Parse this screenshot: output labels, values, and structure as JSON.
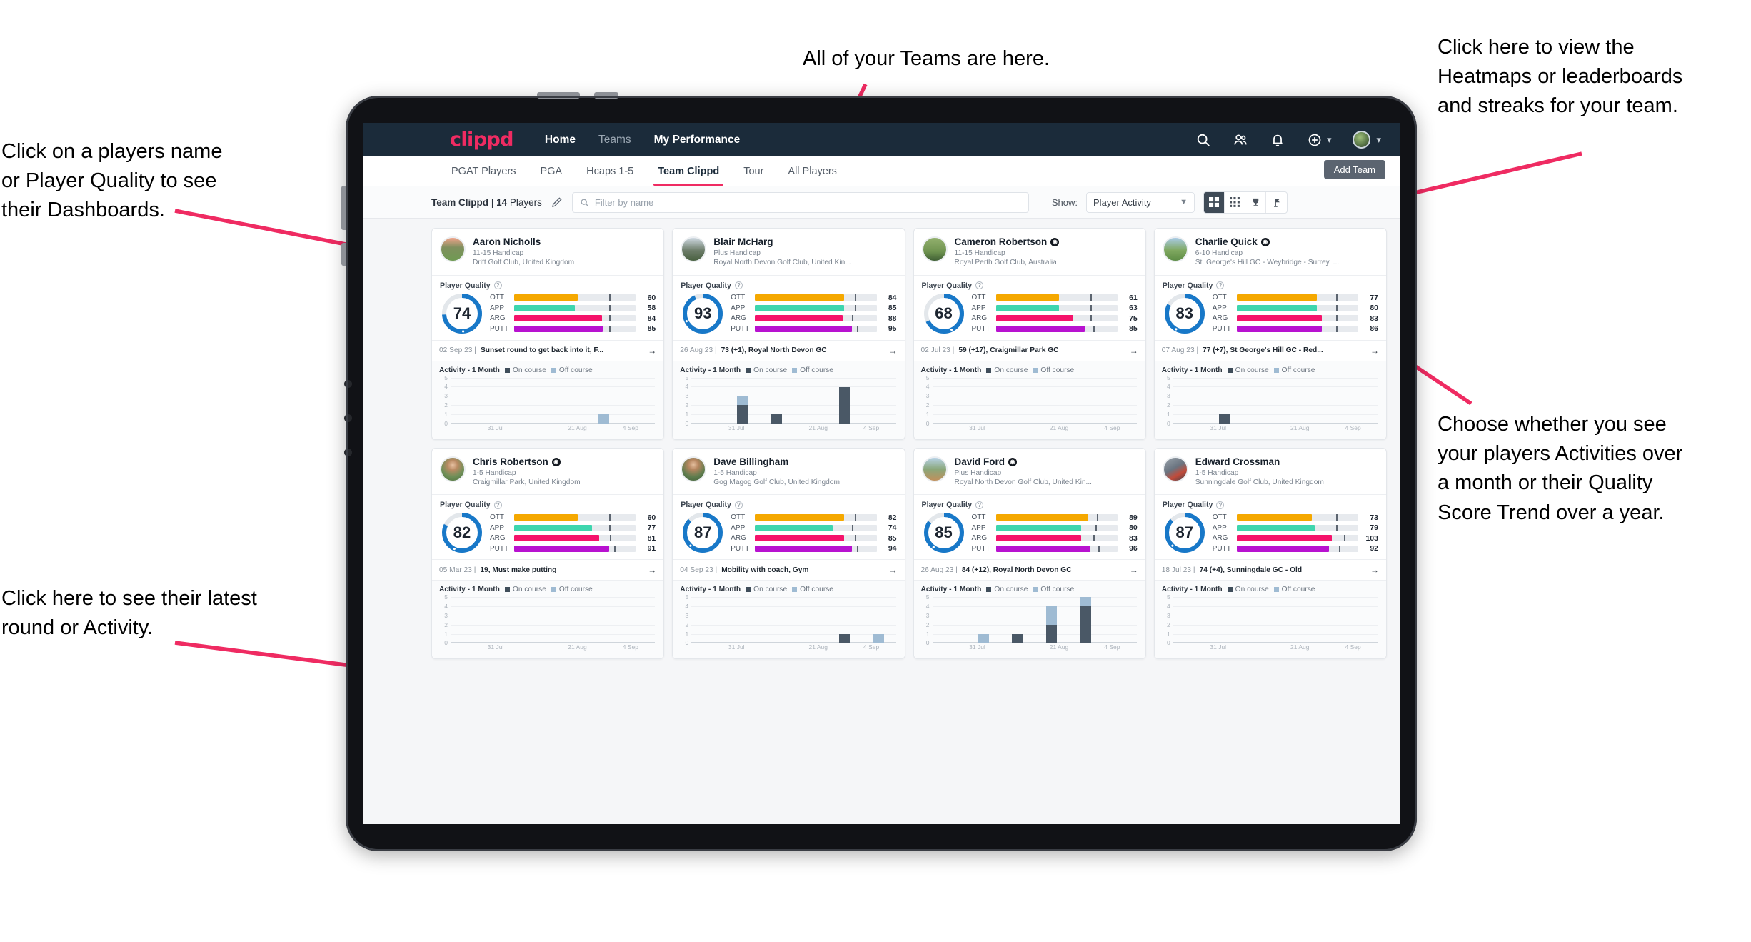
{
  "annotations": {
    "top": "All of your Teams are here.",
    "left_top": "Click on a players name\nor Player Quality to see\ntheir Dashboards.",
    "left_bottom": "Click here to see their latest\nround or Activity.",
    "top_right": "Click here to view the\nHeatmaps or leaderboards\nand streaks for your team.",
    "bottom_right": "Choose whether you see\nyour players Activities over\na month or their Quality\nScore Trend over a year.",
    "arrow_color": "#ef2b62"
  },
  "topnav": {
    "brand": "clippd",
    "links": [
      {
        "label": "Home",
        "active": true
      },
      {
        "label": "Teams",
        "active": false
      },
      {
        "label": "My Performance",
        "active": true
      }
    ],
    "icons": [
      "search-icon",
      "people-icon",
      "bell-icon",
      "plus-circle-icon",
      "avatar"
    ],
    "background": "#1b2b3a"
  },
  "subtabs": {
    "items": [
      {
        "label": "PGAT Players",
        "active": false
      },
      {
        "label": "PGA",
        "active": false
      },
      {
        "label": "Hcaps 1-5",
        "active": false
      },
      {
        "label": "Team Clippd",
        "active": true
      },
      {
        "label": "Tour",
        "active": false
      },
      {
        "label": "All Players",
        "active": false
      }
    ],
    "add_team_label": "Add Team",
    "active_underline_color": "#ef2b62"
  },
  "toolbar": {
    "team_name": "Team Clippd",
    "separator": "|",
    "player_count": "14",
    "players_word": "Players",
    "edit_icon": "pencil-icon",
    "search_placeholder": "Filter by name",
    "show_label": "Show:",
    "show_value": "Player Activity",
    "view_buttons": [
      "grid-large-icon",
      "grid-small-icon",
      "trophy-icon",
      "flag-icon"
    ],
    "active_view": 0
  },
  "card_labels": {
    "player_quality": "Player Quality",
    "activity_title": "Activity - 1 Month",
    "legend_on": "On course",
    "legend_off": "Off course",
    "metric_names": [
      "OTT",
      "APP",
      "ARG",
      "PUTT"
    ],
    "metric_colors": [
      "#f5a800",
      "#3ed6ae",
      "#f5136b",
      "#b812d0"
    ],
    "ring_color": "#1878c8",
    "y_ticks": [
      "5",
      "4",
      "3",
      "2",
      "1",
      "0"
    ],
    "x_ticks": [
      "31 Jul",
      "21 Aug",
      "4 Sep"
    ]
  },
  "players": [
    {
      "name": "Aaron Nicholls",
      "verified": false,
      "handicap": "11-15 Handicap",
      "club": "Drift Golf Club, United Kingdom",
      "quality": 74,
      "metrics": [
        {
          "name": "OTT",
          "value": 60,
          "fill_pct": 52,
          "tick_pct": 78
        },
        {
          "name": "APP",
          "value": 58,
          "fill_pct": 50,
          "tick_pct": 78
        },
        {
          "name": "ARG",
          "value": 84,
          "fill_pct": 72,
          "tick_pct": 78
        },
        {
          "name": "PUTT",
          "value": 85,
          "fill_pct": 73,
          "tick_pct": 78
        }
      ],
      "round_date": "02 Sep 23",
      "round_text": "Sunset round to get back into it, F...",
      "activity": [
        {
          "on": 0,
          "off": 0
        },
        {
          "on": 0,
          "off": 0
        },
        {
          "on": 0,
          "off": 0
        },
        {
          "on": 0,
          "off": 0
        },
        {
          "on": 0,
          "off": 1
        },
        {
          "on": 0,
          "off": 0
        }
      ]
    },
    {
      "name": "Blair McHarg",
      "verified": false,
      "handicap": "Plus Handicap",
      "club": "Royal North Devon Golf Club, United Kin...",
      "quality": 93,
      "metrics": [
        {
          "name": "OTT",
          "value": 84,
          "fill_pct": 73,
          "tick_pct": 82
        },
        {
          "name": "APP",
          "value": 85,
          "fill_pct": 73,
          "tick_pct": 82
        },
        {
          "name": "ARG",
          "value": 88,
          "fill_pct": 72,
          "tick_pct": 80
        },
        {
          "name": "PUTT",
          "value": 95,
          "fill_pct": 80,
          "tick_pct": 84
        }
      ],
      "round_date": "26 Aug 23",
      "round_text": "73 (+1), Royal North Devon GC",
      "activity": [
        {
          "on": 0,
          "off": 0
        },
        {
          "on": 2,
          "off": 1
        },
        {
          "on": 1,
          "off": 0
        },
        {
          "on": 0,
          "off": 0
        },
        {
          "on": 4,
          "off": 0
        },
        {
          "on": 0,
          "off": 0
        }
      ]
    },
    {
      "name": "Cameron Robertson",
      "verified": true,
      "handicap": "11-15 Handicap",
      "club": "Royal Perth Golf Club, Australia",
      "quality": 68,
      "metrics": [
        {
          "name": "OTT",
          "value": 61,
          "fill_pct": 52,
          "tick_pct": 78
        },
        {
          "name": "APP",
          "value": 63,
          "fill_pct": 52,
          "tick_pct": 78
        },
        {
          "name": "ARG",
          "value": 75,
          "fill_pct": 64,
          "tick_pct": 78
        },
        {
          "name": "PUTT",
          "value": 85,
          "fill_pct": 73,
          "tick_pct": 80
        }
      ],
      "round_date": "02 Jul 23",
      "round_text": "59 (+17), Craigmillar Park GC",
      "activity": [
        {
          "on": 0,
          "off": 0
        },
        {
          "on": 0,
          "off": 0
        },
        {
          "on": 0,
          "off": 0
        },
        {
          "on": 0,
          "off": 0
        },
        {
          "on": 0,
          "off": 0
        },
        {
          "on": 0,
          "off": 0
        }
      ]
    },
    {
      "name": "Charlie Quick",
      "verified": true,
      "handicap": "6-10 Handicap",
      "club": "St. George's Hill GC - Weybridge - Surrey, ...",
      "quality": 83,
      "metrics": [
        {
          "name": "OTT",
          "value": 77,
          "fill_pct": 66,
          "tick_pct": 82
        },
        {
          "name": "APP",
          "value": 80,
          "fill_pct": 66,
          "tick_pct": 82
        },
        {
          "name": "ARG",
          "value": 83,
          "fill_pct": 70,
          "tick_pct": 82
        },
        {
          "name": "PUTT",
          "value": 86,
          "fill_pct": 70,
          "tick_pct": 82
        }
      ],
      "round_date": "07 Aug 23",
      "round_text": "77 (+7), St George's Hill GC - Red...",
      "activity": [
        {
          "on": 0,
          "off": 0
        },
        {
          "on": 1,
          "off": 0
        },
        {
          "on": 0,
          "off": 0
        },
        {
          "on": 0,
          "off": 0
        },
        {
          "on": 0,
          "off": 0
        },
        {
          "on": 0,
          "off": 0
        }
      ]
    },
    {
      "name": "Chris Robertson",
      "verified": true,
      "handicap": "1-5 Handicap",
      "club": "Craigmillar Park, United Kingdom",
      "quality": 82,
      "metrics": [
        {
          "name": "OTT",
          "value": 60,
          "fill_pct": 52,
          "tick_pct": 78
        },
        {
          "name": "APP",
          "value": 77,
          "fill_pct": 64,
          "tick_pct": 78
        },
        {
          "name": "ARG",
          "value": 81,
          "fill_pct": 70,
          "tick_pct": 79
        },
        {
          "name": "PUTT",
          "value": 91,
          "fill_pct": 78,
          "tick_pct": 82
        }
      ],
      "round_date": "05 Mar 23",
      "round_text": "19, Must make putting",
      "activity": [
        {
          "on": 0,
          "off": 0
        },
        {
          "on": 0,
          "off": 0
        },
        {
          "on": 0,
          "off": 0
        },
        {
          "on": 0,
          "off": 0
        },
        {
          "on": 0,
          "off": 0
        },
        {
          "on": 0,
          "off": 0
        }
      ]
    },
    {
      "name": "Dave Billingham",
      "verified": false,
      "handicap": "1-5 Handicap",
      "club": "Gog Magog Golf Club, United Kingdom",
      "quality": 87,
      "metrics": [
        {
          "name": "OTT",
          "value": 82,
          "fill_pct": 73,
          "tick_pct": 82
        },
        {
          "name": "APP",
          "value": 74,
          "fill_pct": 64,
          "tick_pct": 80
        },
        {
          "name": "ARG",
          "value": 85,
          "fill_pct": 73,
          "tick_pct": 82
        },
        {
          "name": "PUTT",
          "value": 94,
          "fill_pct": 80,
          "tick_pct": 84
        }
      ],
      "round_date": "04 Sep 23",
      "round_text": "Mobility with coach, Gym",
      "activity": [
        {
          "on": 0,
          "off": 0
        },
        {
          "on": 0,
          "off": 0
        },
        {
          "on": 0,
          "off": 0
        },
        {
          "on": 0,
          "off": 0
        },
        {
          "on": 1,
          "off": 0
        },
        {
          "on": 0,
          "off": 1
        }
      ]
    },
    {
      "name": "David Ford",
      "verified": true,
      "handicap": "Plus Handicap",
      "club": "Royal North Devon Golf Club, United Kin...",
      "quality": 85,
      "metrics": [
        {
          "name": "OTT",
          "value": 89,
          "fill_pct": 76,
          "tick_pct": 83
        },
        {
          "name": "APP",
          "value": 80,
          "fill_pct": 70,
          "tick_pct": 82
        },
        {
          "name": "ARG",
          "value": 83,
          "fill_pct": 70,
          "tick_pct": 80
        },
        {
          "name": "PUTT",
          "value": 96,
          "fill_pct": 78,
          "tick_pct": 84
        }
      ],
      "round_date": "26 Aug 23",
      "round_text": "84 (+12), Royal North Devon GC",
      "activity": [
        {
          "on": 0,
          "off": 0
        },
        {
          "on": 0,
          "off": 1
        },
        {
          "on": 1,
          "off": 0
        },
        {
          "on": 2,
          "off": 2
        },
        {
          "on": 4,
          "off": 1
        },
        {
          "on": 0,
          "off": 0
        }
      ]
    },
    {
      "name": "Edward Crossman",
      "verified": false,
      "handicap": "1-5 Handicap",
      "club": "Sunningdale Golf Club, United Kingdom",
      "quality": 87,
      "metrics": [
        {
          "name": "OTT",
          "value": 73,
          "fill_pct": 62,
          "tick_pct": 82
        },
        {
          "name": "APP",
          "value": 79,
          "fill_pct": 64,
          "tick_pct": 82
        },
        {
          "name": "ARG",
          "value": 103,
          "fill_pct": 78,
          "tick_pct": 88
        },
        {
          "name": "PUTT",
          "value": 92,
          "fill_pct": 76,
          "tick_pct": 84
        }
      ],
      "round_date": "18 Jul 23",
      "round_text": "74 (+4), Sunningdale GC - Old",
      "activity": [
        {
          "on": 0,
          "off": 0
        },
        {
          "on": 0,
          "off": 0
        },
        {
          "on": 0,
          "off": 0
        },
        {
          "on": 0,
          "off": 0
        },
        {
          "on": 0,
          "off": 0
        },
        {
          "on": 0,
          "off": 0
        }
      ]
    }
  ]
}
